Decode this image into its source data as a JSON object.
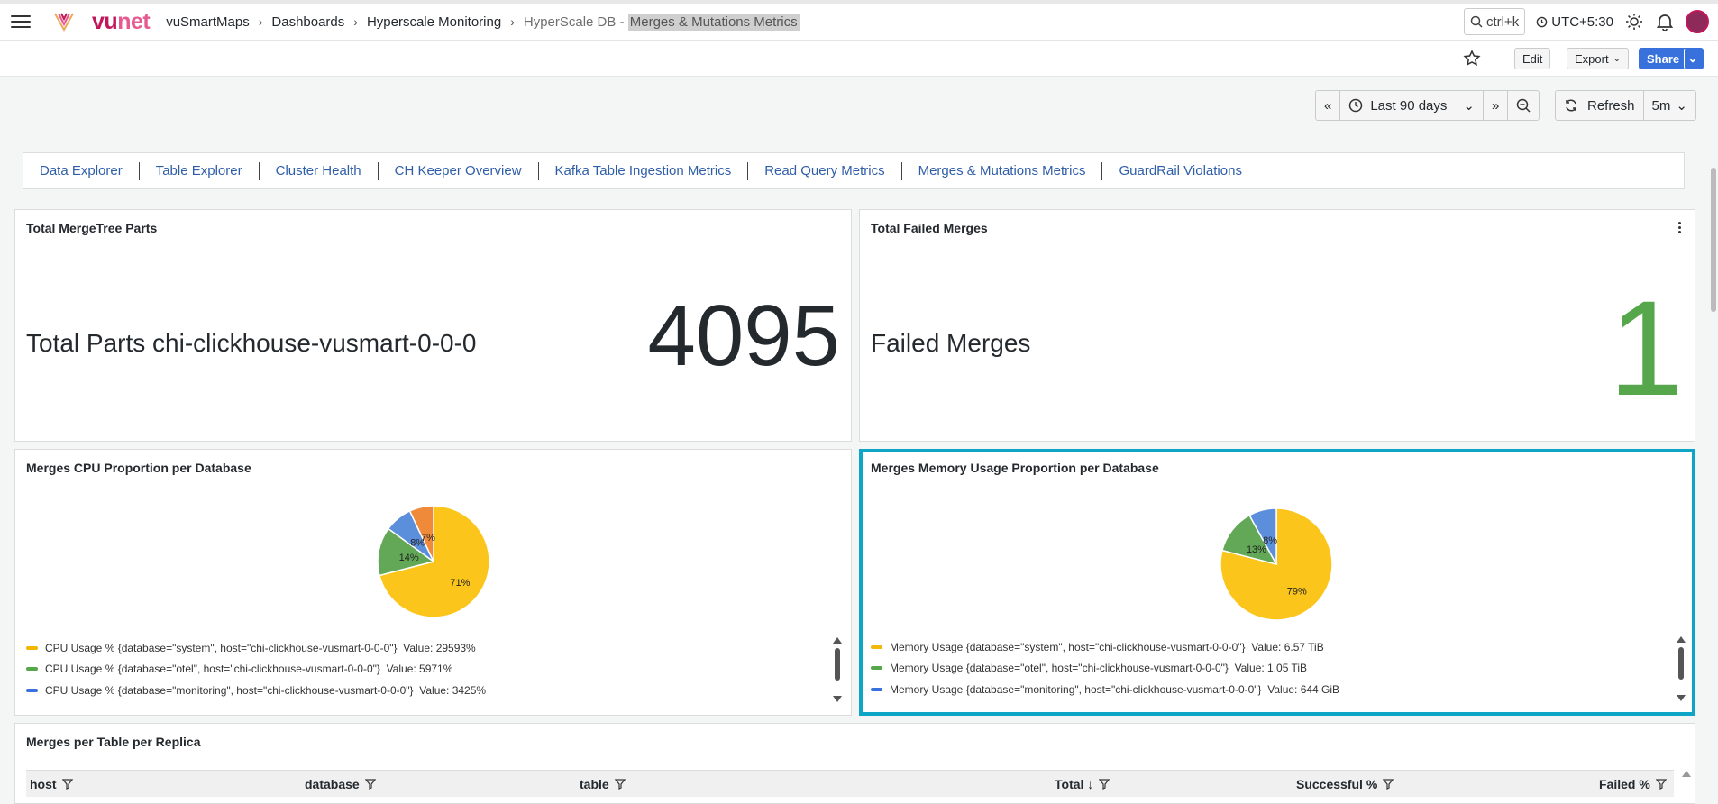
{
  "brand": {
    "logo_text_a": "vu",
    "logo_text_b": "net"
  },
  "breadcrumb": {
    "items": [
      "vuSmartMaps",
      "Dashboards",
      "Hyperscale Monitoring"
    ],
    "current_prefix": "HyperScale DB - ",
    "current_highlight": "Merges & Mutations Metrics"
  },
  "topbar": {
    "search_shortcut": "ctrl+k",
    "timezone": "UTC+5:30"
  },
  "toolbar": {
    "edit": "Edit",
    "export": "Export",
    "share": "Share"
  },
  "timepicker": {
    "range": "Last 90 days",
    "refresh": "Refresh",
    "interval": "5m"
  },
  "tabs": [
    "Data Explorer",
    "Table Explorer",
    "Cluster Health",
    "CH Keeper Overview",
    "Kafka Table Ingestion Metrics",
    "Read Query Metrics",
    "Merges & Mutations Metrics",
    "GuardRail Violations"
  ],
  "panels": {
    "parts": {
      "title": "Total MergeTree Parts",
      "label": "Total Parts chi-clickhouse-vusmart-0-0-0",
      "value": "4095"
    },
    "failed": {
      "title": "Total Failed Merges",
      "label": "Failed Merges",
      "value": "1",
      "value_color": "#56a64b"
    },
    "cpu": {
      "title": "Merges CPU Proportion per Database",
      "slices": [
        {
          "pct": 71,
          "label": "71%",
          "color": "#fbc51b"
        },
        {
          "pct": 14,
          "label": "14%",
          "color": "#62a856"
        },
        {
          "pct": 8,
          "label": "8%",
          "color": "#5b8fdc"
        },
        {
          "pct": 7,
          "label": "7%",
          "color": "#f08a3b"
        }
      ],
      "legend": [
        {
          "text": "CPU Usage % {database=\"system\", host=\"chi-clickhouse-vusmart-0-0-0\"}",
          "value": "Value: 29593%",
          "color": "#f2b807"
        },
        {
          "text": "CPU Usage % {database=\"otel\", host=\"chi-clickhouse-vusmart-0-0-0\"}",
          "value": "Value: 5971%",
          "color": "#56a64b"
        },
        {
          "text": "CPU Usage % {database=\"monitoring\", host=\"chi-clickhouse-vusmart-0-0-0\"}",
          "value": "Value: 3425%",
          "color": "#3871dc"
        }
      ]
    },
    "mem": {
      "title": "Merges Memory Usage Proportion per Database",
      "slices": [
        {
          "pct": 79,
          "label": "79%",
          "color": "#fbc51b"
        },
        {
          "pct": 13,
          "label": "13%",
          "color": "#62a856"
        },
        {
          "pct": 8,
          "label": "8%",
          "color": "#5b8fdc"
        }
      ],
      "legend": [
        {
          "text": "Memory Usage {database=\"system\", host=\"chi-clickhouse-vusmart-0-0-0\"}",
          "value": "Value: 6.57 TiB",
          "color": "#f2b807"
        },
        {
          "text": "Memory Usage {database=\"otel\", host=\"chi-clickhouse-vusmart-0-0-0\"}",
          "value": "Value: 1.05 TiB",
          "color": "#56a64b"
        },
        {
          "text": "Memory Usage {database=\"monitoring\", host=\"chi-clickhouse-vusmart-0-0-0\"}",
          "value": "Value: 644 GiB",
          "color": "#3871dc"
        }
      ],
      "selected_border": "#0ea5c6"
    },
    "table": {
      "title": "Merges per Table per Replica",
      "columns": [
        "host",
        "database",
        "table",
        "Total ↓",
        "Successful %",
        "Failed %"
      ]
    }
  }
}
